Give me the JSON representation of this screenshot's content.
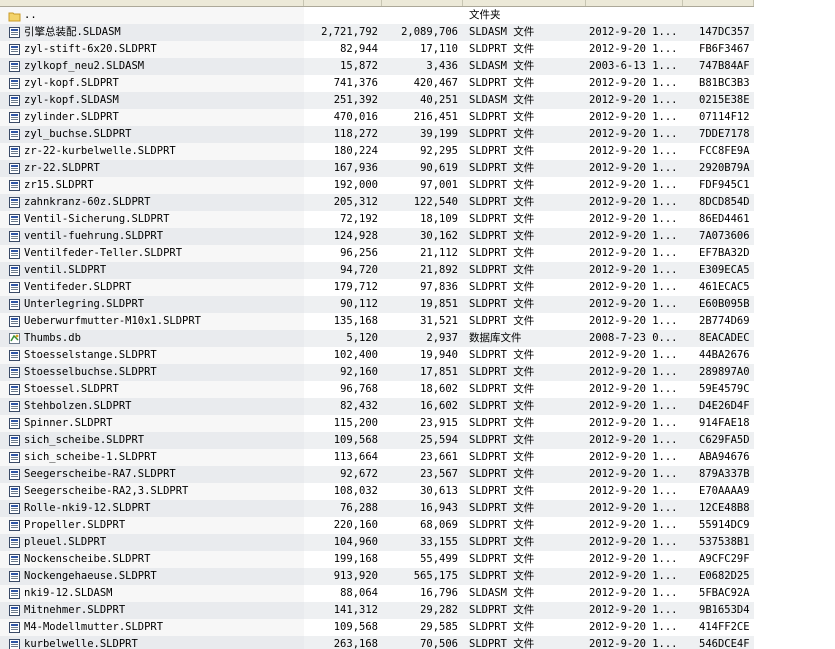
{
  "parent_row": {
    "name": "..",
    "type": "文件夹"
  },
  "files": [
    {
      "name": "引擎总装配.SLDASM",
      "size": "2,721,792",
      "packed": "2,089,706",
      "type": "SLDASM 文件",
      "date": "2012-9-20 1...",
      "crc": "147DC357",
      "icon": "solidworks-doc-icon"
    },
    {
      "name": "zyl-stift-6x20.SLDPRT",
      "size": "82,944",
      "packed": "17,110",
      "type": "SLDPRT 文件",
      "date": "2012-9-20 1...",
      "crc": "FB6F3467",
      "icon": "solidworks-doc-icon"
    },
    {
      "name": "zylkopf_neu2.SLDASM",
      "size": "15,872",
      "packed": "3,436",
      "type": "SLDASM 文件",
      "date": "2003-6-13 1...",
      "crc": "747B84AF",
      "icon": "solidworks-doc-icon"
    },
    {
      "name": "zyl-kopf.SLDPRT",
      "size": "741,376",
      "packed": "420,467",
      "type": "SLDPRT 文件",
      "date": "2012-9-20 1...",
      "crc": "B81BC3B3",
      "icon": "solidworks-doc-icon"
    },
    {
      "name": "zyl-kopf.SLDASM",
      "size": "251,392",
      "packed": "40,251",
      "type": "SLDASM 文件",
      "date": "2012-9-20 1...",
      "crc": "0215E38E",
      "icon": "solidworks-doc-icon"
    },
    {
      "name": "zylinder.SLDPRT",
      "size": "470,016",
      "packed": "216,451",
      "type": "SLDPRT 文件",
      "date": "2012-9-20 1...",
      "crc": "07114F12",
      "icon": "solidworks-doc-icon"
    },
    {
      "name": "zyl_buchse.SLDPRT",
      "size": "118,272",
      "packed": "39,199",
      "type": "SLDPRT 文件",
      "date": "2012-9-20 1...",
      "crc": "7DDE7178",
      "icon": "solidworks-doc-icon"
    },
    {
      "name": "zr-22-kurbelwelle.SLDPRT",
      "size": "180,224",
      "packed": "92,295",
      "type": "SLDPRT 文件",
      "date": "2012-9-20 1...",
      "crc": "FCC8FE9A",
      "icon": "solidworks-doc-icon"
    },
    {
      "name": "zr-22.SLDPRT",
      "size": "167,936",
      "packed": "90,619",
      "type": "SLDPRT 文件",
      "date": "2012-9-20 1...",
      "crc": "2920B79A",
      "icon": "solidworks-doc-icon"
    },
    {
      "name": "zr15.SLDPRT",
      "size": "192,000",
      "packed": "97,001",
      "type": "SLDPRT 文件",
      "date": "2012-9-20 1...",
      "crc": "FDF945C1",
      "icon": "solidworks-doc-icon"
    },
    {
      "name": "zahnkranz-60z.SLDPRT",
      "size": "205,312",
      "packed": "122,540",
      "type": "SLDPRT 文件",
      "date": "2012-9-20 1...",
      "crc": "8DCD854D",
      "icon": "solidworks-doc-icon"
    },
    {
      "name": "Ventil-Sicherung.SLDPRT",
      "size": "72,192",
      "packed": "18,109",
      "type": "SLDPRT 文件",
      "date": "2012-9-20 1...",
      "crc": "86ED4461",
      "icon": "solidworks-doc-icon"
    },
    {
      "name": "ventil-fuehrung.SLDPRT",
      "size": "124,928",
      "packed": "30,162",
      "type": "SLDPRT 文件",
      "date": "2012-9-20 1...",
      "crc": "7A073606",
      "icon": "solidworks-doc-icon"
    },
    {
      "name": "Ventilfeder-Teller.SLDPRT",
      "size": "96,256",
      "packed": "21,112",
      "type": "SLDPRT 文件",
      "date": "2012-9-20 1...",
      "crc": "EF7BA32D",
      "icon": "solidworks-doc-icon"
    },
    {
      "name": "ventil.SLDPRT",
      "size": "94,720",
      "packed": "21,892",
      "type": "SLDPRT 文件",
      "date": "2012-9-20 1...",
      "crc": "E309ECA5",
      "icon": "solidworks-doc-icon"
    },
    {
      "name": "Ventifeder.SLDPRT",
      "size": "179,712",
      "packed": "97,836",
      "type": "SLDPRT 文件",
      "date": "2012-9-20 1...",
      "crc": "461ECAC5",
      "icon": "solidworks-doc-icon"
    },
    {
      "name": "Unterlegring.SLDPRT",
      "size": "90,112",
      "packed": "19,851",
      "type": "SLDPRT 文件",
      "date": "2012-9-20 1...",
      "crc": "E60B095B",
      "icon": "solidworks-doc-icon"
    },
    {
      "name": "Ueberwurfmutter-M10x1.SLDPRT",
      "size": "135,168",
      "packed": "31,521",
      "type": "SLDPRT 文件",
      "date": "2012-9-20 1...",
      "crc": "2B774D69",
      "icon": "solidworks-doc-icon"
    },
    {
      "name": "Thumbs.db",
      "size": "5,120",
      "packed": "2,937",
      "type": "数据库文件",
      "date": "2008-7-23 0...",
      "crc": "8EACADEC",
      "icon": "database-file-icon"
    },
    {
      "name": "Stoesselstange.SLDPRT",
      "size": "102,400",
      "packed": "19,940",
      "type": "SLDPRT 文件",
      "date": "2012-9-20 1...",
      "crc": "44BA2676",
      "icon": "solidworks-doc-icon"
    },
    {
      "name": "Stoesselbuchse.SLDPRT",
      "size": "92,160",
      "packed": "17,851",
      "type": "SLDPRT 文件",
      "date": "2012-9-20 1...",
      "crc": "289897A0",
      "icon": "solidworks-doc-icon"
    },
    {
      "name": "Stoessel.SLDPRT",
      "size": "96,768",
      "packed": "18,602",
      "type": "SLDPRT 文件",
      "date": "2012-9-20 1...",
      "crc": "59E4579C",
      "icon": "solidworks-doc-icon"
    },
    {
      "name": "Stehbolzen.SLDPRT",
      "size": "82,432",
      "packed": "16,602",
      "type": "SLDPRT 文件",
      "date": "2012-9-20 1...",
      "crc": "D4E26D4F",
      "icon": "solidworks-doc-icon"
    },
    {
      "name": "Spinner.SLDPRT",
      "size": "115,200",
      "packed": "23,915",
      "type": "SLDPRT 文件",
      "date": "2012-9-20 1...",
      "crc": "914FAE18",
      "icon": "solidworks-doc-icon"
    },
    {
      "name": "sich_scheibe.SLDPRT",
      "size": "109,568",
      "packed": "25,594",
      "type": "SLDPRT 文件",
      "date": "2012-9-20 1...",
      "crc": "C629FA5D",
      "icon": "solidworks-doc-icon"
    },
    {
      "name": "sich_scheibe-1.SLDPRT",
      "size": "113,664",
      "packed": "23,661",
      "type": "SLDPRT 文件",
      "date": "2012-9-20 1...",
      "crc": "ABA94676",
      "icon": "solidworks-doc-icon"
    },
    {
      "name": "Seegerscheibe-RA7.SLDPRT",
      "size": "92,672",
      "packed": "23,567",
      "type": "SLDPRT 文件",
      "date": "2012-9-20 1...",
      "crc": "879A337B",
      "icon": "solidworks-doc-icon"
    },
    {
      "name": "Seegerscheibe-RA2,3.SLDPRT",
      "size": "108,032",
      "packed": "30,613",
      "type": "SLDPRT 文件",
      "date": "2012-9-20 1...",
      "crc": "E70AAAA9",
      "icon": "solidworks-doc-icon"
    },
    {
      "name": "Rolle-nki9-12.SLDPRT",
      "size": "76,288",
      "packed": "16,943",
      "type": "SLDPRT 文件",
      "date": "2012-9-20 1...",
      "crc": "12CE48B8",
      "icon": "solidworks-doc-icon"
    },
    {
      "name": "Propeller.SLDPRT",
      "size": "220,160",
      "packed": "68,069",
      "type": "SLDPRT 文件",
      "date": "2012-9-20 1...",
      "crc": "55914DC9",
      "icon": "solidworks-doc-icon"
    },
    {
      "name": "pleuel.SLDPRT",
      "size": "104,960",
      "packed": "33,155",
      "type": "SLDPRT 文件",
      "date": "2012-9-20 1...",
      "crc": "537538B1",
      "icon": "solidworks-doc-icon"
    },
    {
      "name": "Nockenscheibe.SLDPRT",
      "size": "199,168",
      "packed": "55,499",
      "type": "SLDPRT 文件",
      "date": "2012-9-20 1...",
      "crc": "A9CFC29F",
      "icon": "solidworks-doc-icon"
    },
    {
      "name": "Nockengehaeuse.SLDPRT",
      "size": "913,920",
      "packed": "565,175",
      "type": "SLDPRT 文件",
      "date": "2012-9-20 1...",
      "crc": "E0682D25",
      "icon": "solidworks-doc-icon"
    },
    {
      "name": "nki9-12.SLDASM",
      "size": "88,064",
      "packed": "16,796",
      "type": "SLDASM 文件",
      "date": "2012-9-20 1...",
      "crc": "5FBAC92A",
      "icon": "solidworks-doc-icon"
    },
    {
      "name": "Mitnehmer.SLDPRT",
      "size": "141,312",
      "packed": "29,282",
      "type": "SLDPRT 文件",
      "date": "2012-9-20 1...",
      "crc": "9B1653D4",
      "icon": "solidworks-doc-icon"
    },
    {
      "name": "M4-Modellmutter.SLDPRT",
      "size": "109,568",
      "packed": "29,585",
      "type": "SLDPRT 文件",
      "date": "2012-9-20 1...",
      "crc": "414FF2CE",
      "icon": "solidworks-doc-icon"
    },
    {
      "name": "kurbelwelle.SLDPRT",
      "size": "263,168",
      "packed": "70,506",
      "type": "SLDPRT 文件",
      "date": "2012-9-20 1...",
      "crc": "546DCE4F",
      "icon": "solidworks-doc-icon"
    }
  ]
}
